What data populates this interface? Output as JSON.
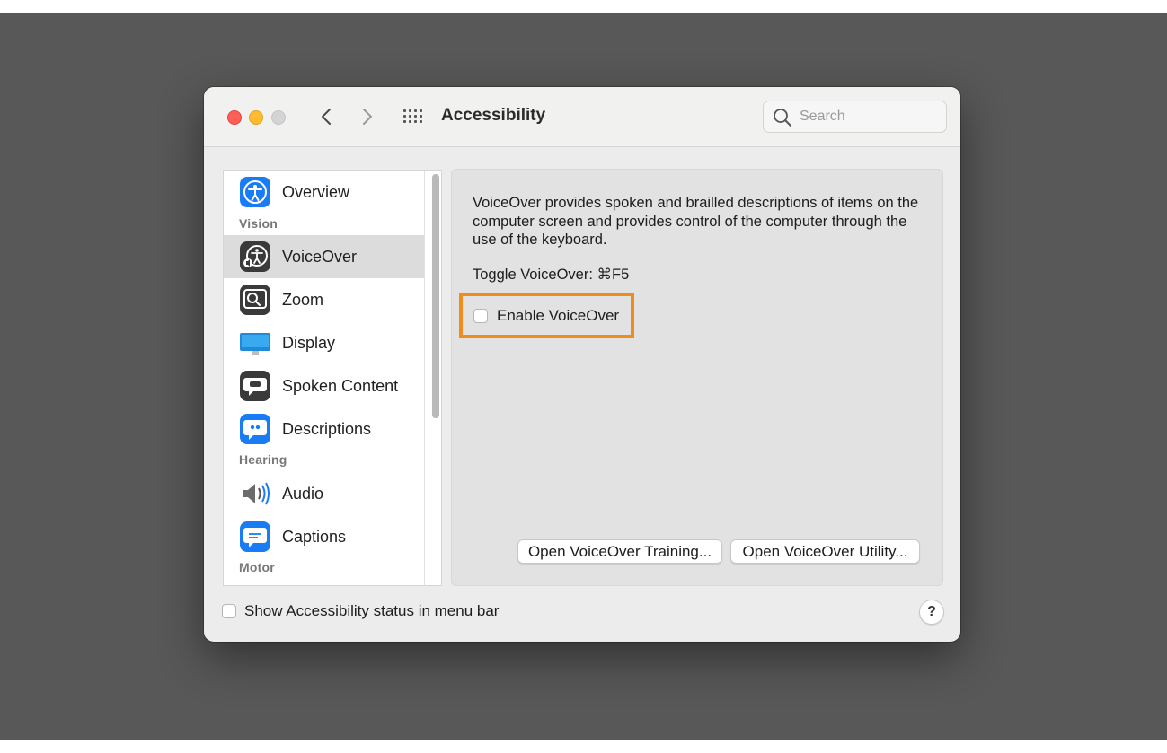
{
  "window": {
    "title": "Accessibility",
    "search_placeholder": "Search"
  },
  "sidebar": {
    "items": [
      {
        "label": "Overview",
        "icon": "accessibility-icon"
      },
      {
        "label": "VoiceOver",
        "icon": "voiceover-icon",
        "selected": true
      },
      {
        "label": "Zoom",
        "icon": "zoom-icon"
      },
      {
        "label": "Display",
        "icon": "display-icon"
      },
      {
        "label": "Spoken Content",
        "icon": "speech-bubble-icon"
      },
      {
        "label": "Descriptions",
        "icon": "descriptions-icon"
      },
      {
        "label": "Audio",
        "icon": "speaker-icon"
      },
      {
        "label": "Captions",
        "icon": "captions-icon"
      }
    ],
    "headers": {
      "vision": "Vision",
      "hearing": "Hearing",
      "motor": "Motor"
    }
  },
  "content": {
    "description": "VoiceOver provides spoken and brailled descriptions of items on the computer screen and provides control of the computer through the use of the keyboard.",
    "toggle_label": "Toggle VoiceOver:",
    "toggle_shortcut": "⌘F5",
    "enable_label": "Enable VoiceOver",
    "enable_checked": false,
    "training_button": "Open VoiceOver Training...",
    "utility_button": "Open VoiceOver Utility..."
  },
  "footer": {
    "status_label": "Show Accessibility status in menu bar",
    "status_checked": false,
    "help_label": "?"
  },
  "colors": {
    "highlight": "#f08c1c",
    "selected_row": "#dcdcdc",
    "accent_blue": "#1a7cf5"
  }
}
